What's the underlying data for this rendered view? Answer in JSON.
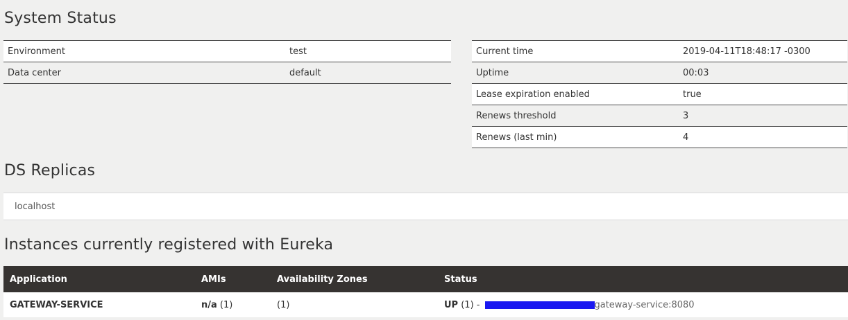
{
  "system_status": {
    "title": "System Status",
    "left_rows": [
      {
        "label": "Environment",
        "value": "test"
      },
      {
        "label": "Data center",
        "value": "default"
      }
    ],
    "right_rows": [
      {
        "label": "Current time",
        "value": "2019-04-11T18:48:17 -0300"
      },
      {
        "label": "Uptime",
        "value": "00:03"
      },
      {
        "label": "Lease expiration enabled",
        "value": "true"
      },
      {
        "label": "Renews threshold",
        "value": "3"
      },
      {
        "label": "Renews (last min)",
        "value": "4"
      }
    ]
  },
  "ds_replicas": {
    "title": "DS Replicas",
    "items": [
      "localhost"
    ]
  },
  "instances": {
    "title": "Instances currently registered with Eureka",
    "columns": [
      "Application",
      "AMIs",
      "Availability Zones",
      "Status"
    ],
    "rows": [
      {
        "application": "GATEWAY-SERVICE",
        "amis_label": "n/a",
        "amis_count": "(1)",
        "zones": "(1)",
        "status_label": "UP",
        "status_count": "(1) -",
        "instance_link": "gateway-service:8080"
      }
    ]
  },
  "colors": {
    "background": "#f0f0ef",
    "table_header_bg": "#363331",
    "redaction": "#1a18f0"
  }
}
